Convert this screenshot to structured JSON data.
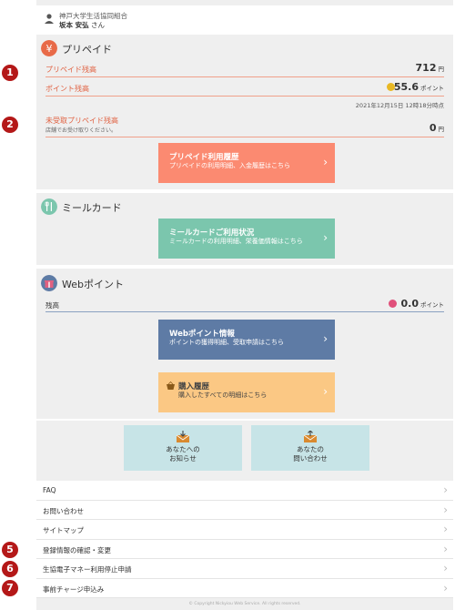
{
  "user": {
    "org": "神戸大学生活協同組合",
    "name": "坂本 安弘",
    "suffix": "さん"
  },
  "prepaid": {
    "title": "プリペイド",
    "balance_label": "プリペイド残高",
    "balance_value": "712",
    "balance_unit": "円",
    "points_label": "ポイント残高",
    "points_value": "55.6",
    "points_unit": "ポイント",
    "as_of": "2021年12月15日 12時18分時点",
    "unreceived_label": "未受取プリペイド残高",
    "unreceived_sub": "店舗でお受け取りください。",
    "unreceived_value": "0",
    "unreceived_unit": "円",
    "history_title": "プリペイド利用履歴",
    "history_sub": "プリペイドの利用明細、入金履歴はこちら"
  },
  "meal": {
    "title": "ミールカード",
    "usage_title": "ミールカードご利用状況",
    "usage_sub": "ミールカードの利用明細、栄養価情報はこちら"
  },
  "webpoint": {
    "title": "Webポイント",
    "balance_label": "残高",
    "balance_value": "0.0",
    "balance_unit": "ポイント",
    "info_title": "Webポイント情報",
    "info_sub": "ポイントの獲得明細、受取申請はこちら"
  },
  "purchase": {
    "title": "購入履歴",
    "sub": "購入したすべての明細はこちら"
  },
  "notices": {
    "to_you": "あなたへの\nお知らせ",
    "your_inquiries": "あなたの\n問い合わせ"
  },
  "menu": [
    "FAQ",
    "お問い合わせ",
    "サイトマップ",
    "登録情報の確認・変更",
    "生協電子マネー利用停止申請",
    "事前チャージ申込み"
  ],
  "markers": [
    "1",
    "2",
    "5",
    "6",
    "7"
  ],
  "footer": "© Copyright Nickyiou Web Service. All rights reserved.",
  "colors": {
    "prepaid_accent": "#e06040",
    "prepaid_button": "#fb8a71",
    "meal_button": "#7bc6ad",
    "webpoint_button": "#5e7ba5",
    "purchase_button": "#fbc884",
    "notice_card": "#c7e4e7",
    "marker": "#b41818"
  }
}
